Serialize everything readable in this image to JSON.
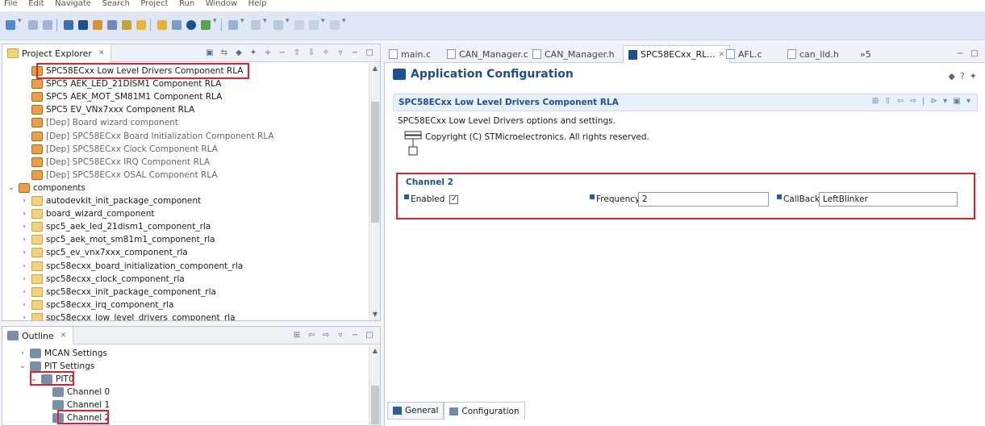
{
  "menu": [
    "File",
    "Edit",
    "Navigate",
    "Search",
    "Project",
    "Run",
    "Window",
    "Help"
  ],
  "project_explorer": {
    "title": "Project Explorer",
    "items": [
      {
        "label": "SPC58ECxx Low Level Drivers Component RLA",
        "dep": false,
        "indent": 1,
        "twisty": ""
      },
      {
        "label": "SPC5 AEK_LED_21DISM1 Component RLA",
        "dep": false,
        "indent": 1,
        "twisty": ""
      },
      {
        "label": "SPC5 AEK_MOT_SM81M1 Component RLA",
        "dep": false,
        "indent": 1,
        "twisty": ""
      },
      {
        "label": "SPC5 EV_VNx7xxx Component RLA",
        "dep": false,
        "indent": 1,
        "twisty": ""
      },
      {
        "label": "[Dep] Board wizard component",
        "dep": true,
        "indent": 1,
        "twisty": ""
      },
      {
        "label": "[Dep] SPC58ECxx Board Initialization Component RLA",
        "dep": true,
        "indent": 1,
        "twisty": ""
      },
      {
        "label": "[Dep] SPC58ECxx Clock Component RLA",
        "dep": true,
        "indent": 1,
        "twisty": ""
      },
      {
        "label": "[Dep] SPC58ECxx IRQ Component RLA",
        "dep": true,
        "indent": 1,
        "twisty": ""
      },
      {
        "label": "[Dep] SPC58ECxx OSAL Component RLA",
        "dep": true,
        "indent": 1,
        "twisty": ""
      },
      {
        "label": "components",
        "dep": false,
        "indent": 0,
        "twisty": "v"
      },
      {
        "label": "autodevkit_init_package_component",
        "dep": false,
        "indent": 1,
        "twisty": ">"
      },
      {
        "label": "board_wizard_component",
        "dep": false,
        "indent": 1,
        "twisty": ">"
      },
      {
        "label": "spc5_aek_led_21dism1_component_rla",
        "dep": false,
        "indent": 1,
        "twisty": ">"
      },
      {
        "label": "spc5_aek_mot_sm81m1_component_rla",
        "dep": false,
        "indent": 1,
        "twisty": ">"
      },
      {
        "label": "spc5_ev_vnx7xxx_component_rla",
        "dep": false,
        "indent": 1,
        "twisty": ">"
      },
      {
        "label": "spc58ecxx_board_initialization_component_rla",
        "dep": false,
        "indent": 1,
        "twisty": ">"
      },
      {
        "label": "spc58ecxx_clock_component_rla",
        "dep": false,
        "indent": 1,
        "twisty": ">"
      },
      {
        "label": "spc58ecxx_init_package_component_rla",
        "dep": false,
        "indent": 1,
        "twisty": ">"
      },
      {
        "label": "spc58ecxx_irq_component_rla",
        "dep": false,
        "indent": 1,
        "twisty": ">"
      },
      {
        "label": "spc58ecxx_low_level_drivers_component_rla",
        "dep": false,
        "indent": 1,
        "twisty": ">"
      }
    ]
  },
  "outline": {
    "title": "Outline",
    "items": [
      {
        "label": "MCAN Settings",
        "indent": 0,
        "twisty": ">"
      },
      {
        "label": "PIT Settings",
        "indent": 0,
        "twisty": "v"
      },
      {
        "label": "PIT0",
        "indent": 1,
        "twisty": "v"
      },
      {
        "label": "Channel 0",
        "indent": 2,
        "twisty": ""
      },
      {
        "label": "Channel 1",
        "indent": 2,
        "twisty": ""
      },
      {
        "label": "Channel 2",
        "indent": 2,
        "twisty": ""
      }
    ]
  },
  "editor_tabs": [
    {
      "label": "main.c",
      "active": false
    },
    {
      "label": "CAN_Manager.c",
      "active": false
    },
    {
      "label": "CAN_Manager.h",
      "active": false
    },
    {
      "label": "SPC58ECxx_RL...",
      "active": true
    },
    {
      "label": "AFL.c",
      "active": false
    },
    {
      "label": "can_lld.h",
      "active": false
    }
  ],
  "editor_tabs_overflow": "»5",
  "editor": {
    "title": "Application Configuration",
    "section_title": "SPC58ECxx Low Level Drivers Component RLA",
    "description": "SPC58ECxx Low Level Drivers options and settings.",
    "copyright": "Copyright (C) STMicroelectronics. All rights reserved.",
    "channel": {
      "title": "Channel 2",
      "enabled_label": "Enabled",
      "enabled": true,
      "frequency_label": "Frequency",
      "frequency_value": "2",
      "callback_label": "CallBack",
      "callback_value": "LeftBlinker"
    },
    "bottom_tabs": [
      "General",
      "Configuration"
    ]
  },
  "colors": {
    "accent": "#1d4f91",
    "highlight": "#e0202a"
  }
}
